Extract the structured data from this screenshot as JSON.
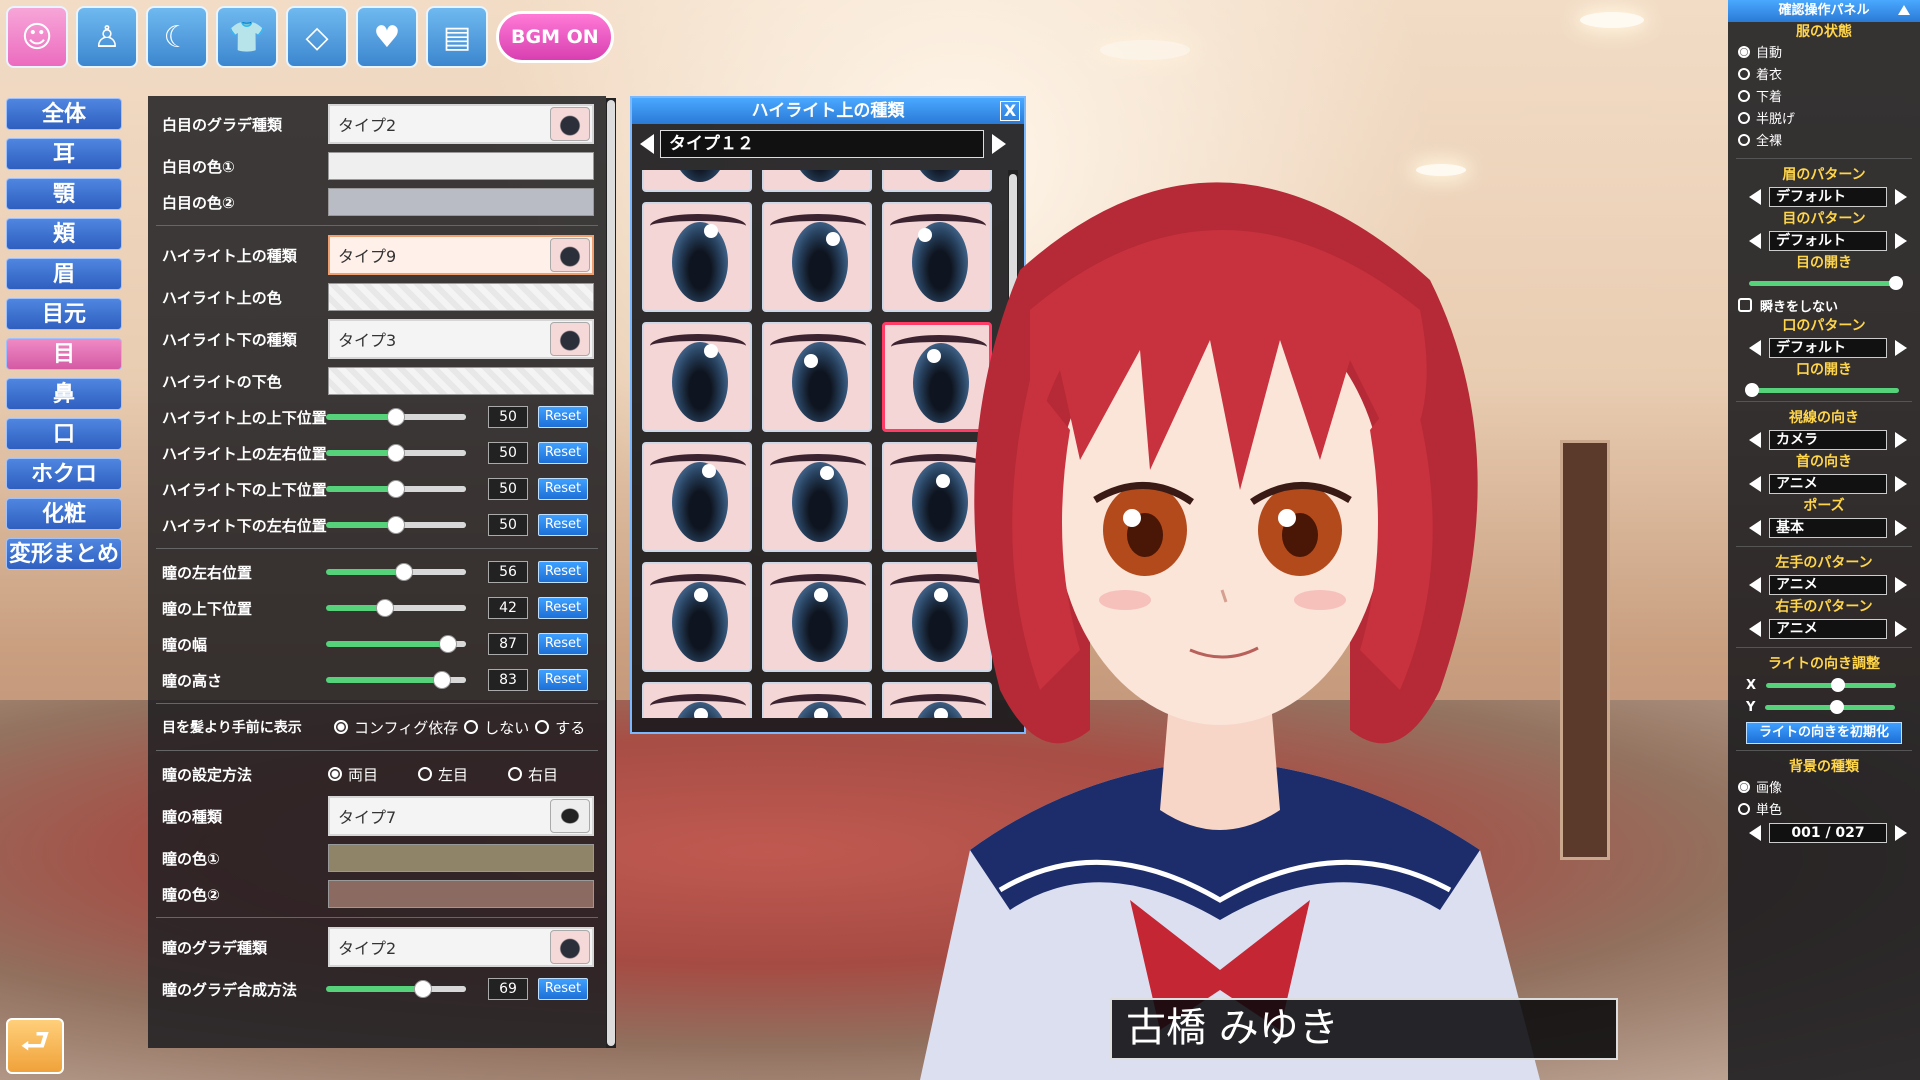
{
  "toolbar": {
    "buttons": [
      {
        "name": "face-icon",
        "glyph": "☺"
      },
      {
        "name": "body-icon",
        "glyph": "♙"
      },
      {
        "name": "hair-icon",
        "glyph": "☾"
      },
      {
        "name": "clothes-icon",
        "glyph": "👕"
      },
      {
        "name": "accessory-icon",
        "glyph": "◇"
      },
      {
        "name": "heart-icon",
        "glyph": "♥"
      },
      {
        "name": "document-icon",
        "glyph": "▤"
      }
    ],
    "bgm_label": "BGM ON"
  },
  "categories": [
    "全体",
    "耳",
    "顎",
    "頬",
    "眉",
    "目元",
    "目",
    "鼻",
    "口",
    "ホクロ",
    "化粧",
    "変形まとめ"
  ],
  "active_category": "目",
  "panel": {
    "sclera_grad_label": "白目のグラデ種類",
    "sclera_grad_value": "タイプ2",
    "sclera_color1_label": "白目の色①",
    "sclera_color1": "#efefef",
    "sclera_color2_label": "白目の色②",
    "sclera_color2": "#b9bcc4",
    "hl_upper_type_label": "ハイライト上の種類",
    "hl_upper_type_value": "タイプ9",
    "hl_upper_color_label": "ハイライト上の色",
    "hl_lower_type_label": "ハイライト下の種類",
    "hl_lower_type_value": "タイプ3",
    "hl_lower_color_label": "ハイライトの下色",
    "sliders": [
      {
        "label": "ハイライト上の上下位置",
        "value": "50",
        "pct": 50
      },
      {
        "label": "ハイライト上の左右位置",
        "value": "50",
        "pct": 50
      },
      {
        "label": "ハイライト下の上下位置",
        "value": "50",
        "pct": 50
      },
      {
        "label": "ハイライト下の左右位置",
        "value": "50",
        "pct": 50
      },
      {
        "label": "瞳の左右位置",
        "value": "56",
        "pct": 56
      },
      {
        "label": "瞳の上下位置",
        "value": "42",
        "pct": 42
      },
      {
        "label": "瞳の幅",
        "value": "87",
        "pct": 87
      },
      {
        "label": "瞳の高さ",
        "value": "83",
        "pct": 83
      }
    ],
    "reset_label": "Reset",
    "front_label": "目を髪より手前に表示",
    "front_options": [
      "コンフィグ依存",
      "しない",
      "する"
    ],
    "pupil_method_label": "瞳の設定方法",
    "pupil_method_options": [
      "両目",
      "左目",
      "右目"
    ],
    "pupil_type_label": "瞳の種類",
    "pupil_type_value": "タイプ7",
    "pupil_color1_label": "瞳の色①",
    "pupil_color1": "#8f8468",
    "pupil_color2_label": "瞳の色②",
    "pupil_color2": "#8b6a62",
    "pupil_grad_label": "瞳のグラデ種類",
    "pupil_grad_value": "タイプ2",
    "pupil_grad_blend_label": "瞳のグラデ合成方法",
    "pupil_grad_blend_value": "69",
    "pupil_grad_blend_pct": 69
  },
  "popup": {
    "title": "ハイライト上の種類",
    "close_label": "X",
    "current_value": "タイプ１２",
    "selected_index": 8
  },
  "right_panel": {
    "title": "確認操作パネル",
    "clothes_state_label": "服の状態",
    "clothes_options": [
      "自動",
      "着衣",
      "下着",
      "半脱げ",
      "全裸"
    ],
    "eyebrow_pattern_label": "眉のパターン",
    "eyebrow_pattern_value": "デフォルト",
    "eye_pattern_label": "目のパターン",
    "eye_pattern_value": "デフォルト",
    "eye_open_label": "目の開き",
    "eye_open_pct": 98,
    "no_blink_label": "瞬きをしない",
    "mouth_pattern_label": "口のパターン",
    "mouth_pattern_value": "デフォルト",
    "mouth_open_label": "口の開き",
    "mouth_open_pct": 2,
    "gaze_label": "視線の向き",
    "gaze_value": "カメラ",
    "neck_label": "首の向き",
    "neck_value": "アニメ",
    "pose_label": "ポーズ",
    "pose_value": "基本",
    "left_hand_label": "左手のパターン",
    "left_hand_value": "アニメ",
    "right_hand_label": "右手のパターン",
    "right_hand_value": "アニメ",
    "light_label": "ライトの向き調整",
    "light_x_label": "X",
    "light_y_label": "Y",
    "light_x_pct": 55,
    "light_y_pct": 55,
    "light_reset_label": "ライトの向きを初期化",
    "bg_type_label": "背景の種類",
    "bg_options": [
      "画像",
      "単色"
    ],
    "bg_index_value": "001 / 027"
  },
  "character_name": "古橋 みゆき",
  "colors": {
    "hair": "#c8323e",
    "uniform_navy": "#1d2d6b",
    "ribbon": "#c52634",
    "skin": "#fbe4d8"
  }
}
